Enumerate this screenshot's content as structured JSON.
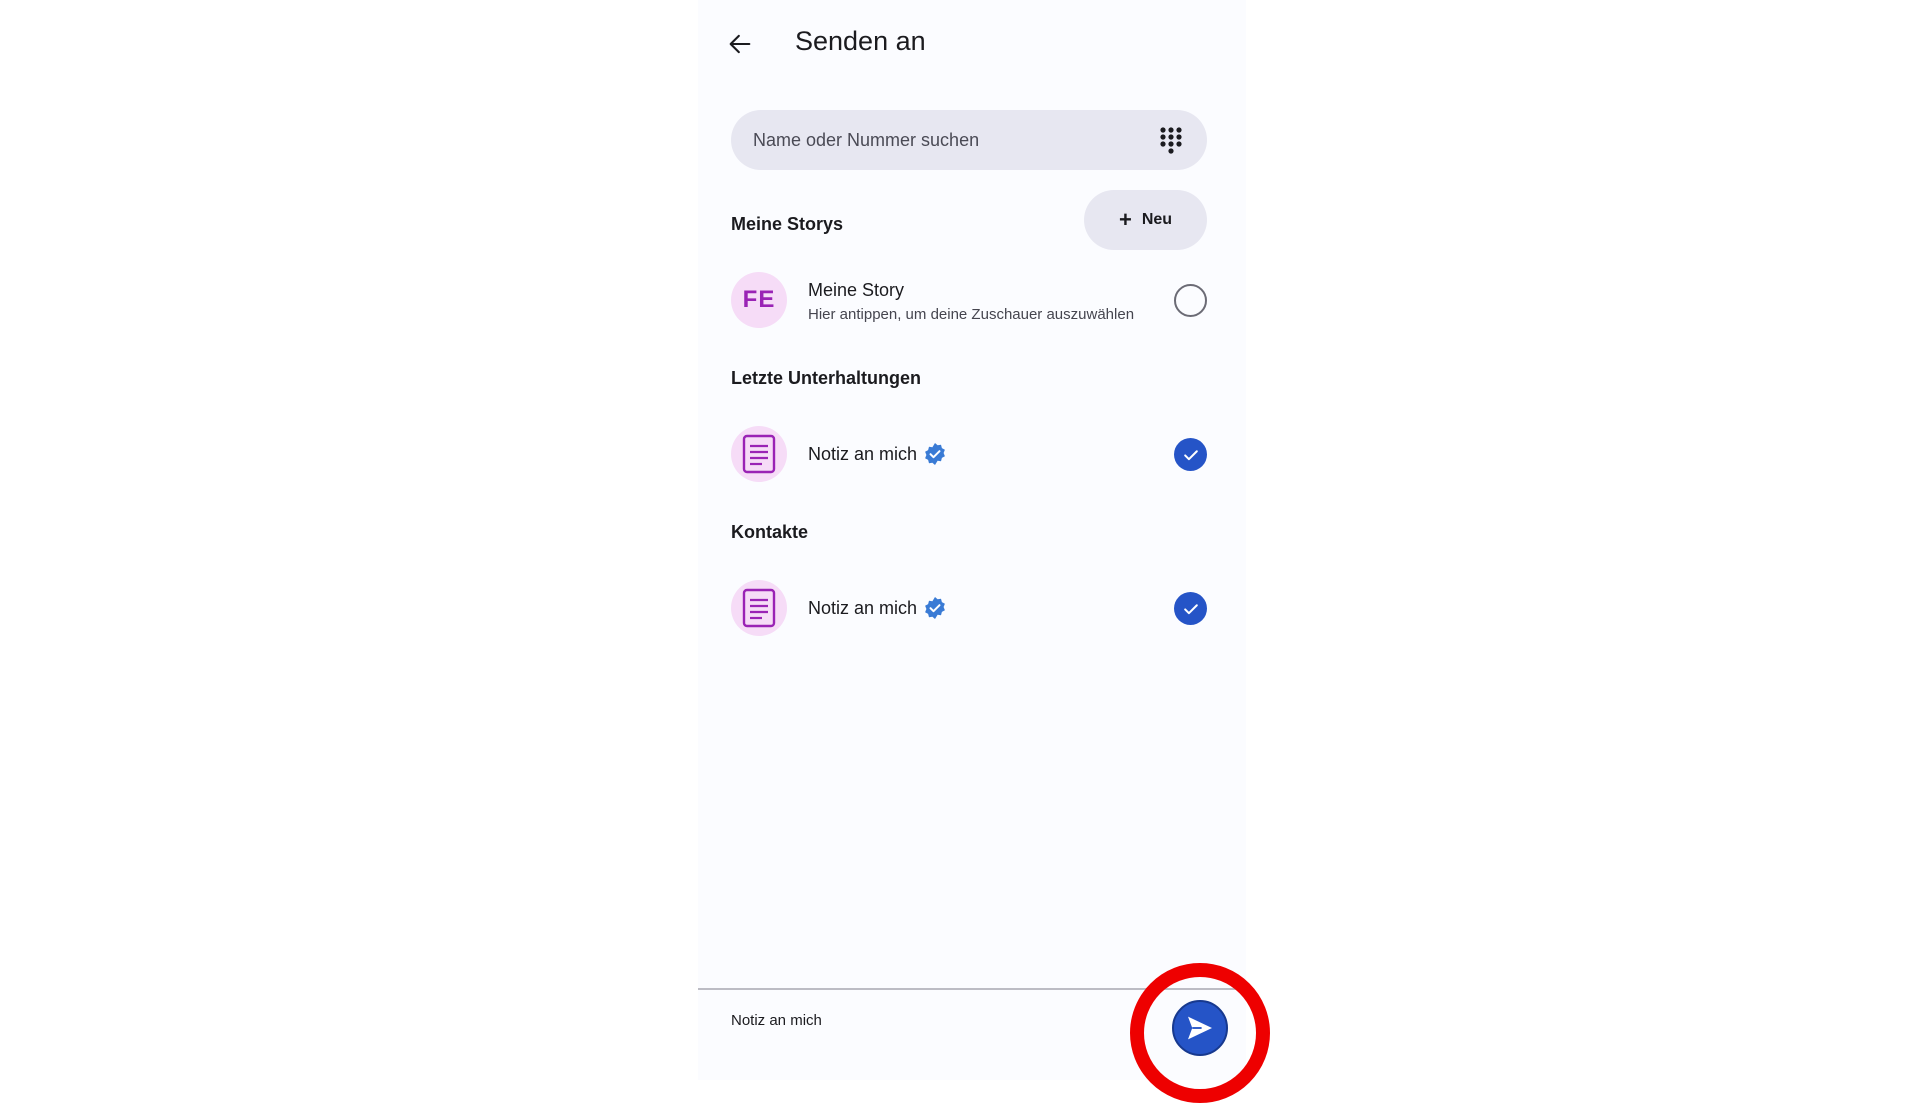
{
  "header": {
    "title": "Senden an"
  },
  "search": {
    "placeholder": "Name oder Nummer suchen"
  },
  "stories": {
    "heading": "Meine Storys",
    "new_label": "Neu",
    "items": [
      {
        "initials": "FE",
        "title": "Meine Story",
        "subtitle": "Hier antippen, um deine Zuschauer auszuwählen"
      }
    ]
  },
  "recent": {
    "heading": "Letzte Unterhaltungen",
    "items": [
      {
        "title": "Notiz an mich",
        "verified": true,
        "selected": true
      }
    ]
  },
  "contacts": {
    "heading": "Kontakte",
    "items": [
      {
        "title": "Notiz an mich",
        "verified": true,
        "selected": true
      }
    ]
  },
  "footer": {
    "recipients": "Notiz an mich"
  },
  "colors": {
    "accent": "#2554c7",
    "avatar_bg": "#f6dcf7",
    "avatar_fg": "#9a23b5",
    "verified": "#3a7bd5",
    "highlight": "#ee0000"
  },
  "icons": {
    "back": "arrow-left-icon",
    "dialpad": "dialpad-icon",
    "add": "plus-icon",
    "note": "note-icon",
    "verified": "verified-badge-icon",
    "selected": "check-icon",
    "send": "send-icon"
  }
}
